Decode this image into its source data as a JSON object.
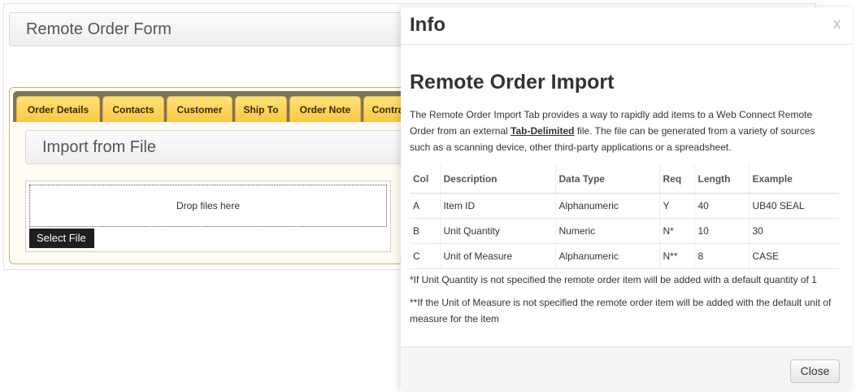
{
  "form": {
    "title": "Remote Order Form",
    "tabs": [
      {
        "label": "Order Details"
      },
      {
        "label": "Contacts"
      },
      {
        "label": "Customer"
      },
      {
        "label": "Ship To"
      },
      {
        "label": "Order Note"
      },
      {
        "label": "Contra"
      }
    ],
    "import_section_title": "Import from File",
    "drop_zone_label": "Drop files here",
    "select_file_label": "Select File"
  },
  "modal": {
    "title": "Info",
    "close_x": "x",
    "heading": "Remote Order Import",
    "intro_before": "The Remote Order Import Tab provides a way to rapidly add items to a Web Connect Remote Order from an external ",
    "intro_link": "Tab-Delimited",
    "intro_after": " file. The file can be generated from a variety of sources such as a scanning device, other third-party applications or a spreadsheet.",
    "table": {
      "headers": [
        "Col",
        "Description",
        "Data Type",
        "Req",
        "Length",
        "Example"
      ],
      "rows": [
        [
          "A",
          "Item ID",
          "Alphanumeric",
          "Y",
          "40",
          "UB40 SEAL"
        ],
        [
          "B",
          "Unit Quantity",
          "Numeric",
          "N*",
          "10",
          "30"
        ],
        [
          "C",
          "Unit of Measure",
          "Alphanumeric",
          "N**",
          "8",
          "CASE"
        ]
      ]
    },
    "note1": "*If Unit Quantity is not specified the remote order item will be added with a default quantity of 1",
    "note2": "**If the Unit of Measure is not specified the remote order item will be added with the default unit of measure for the item",
    "close_button_label": "Close"
  }
}
